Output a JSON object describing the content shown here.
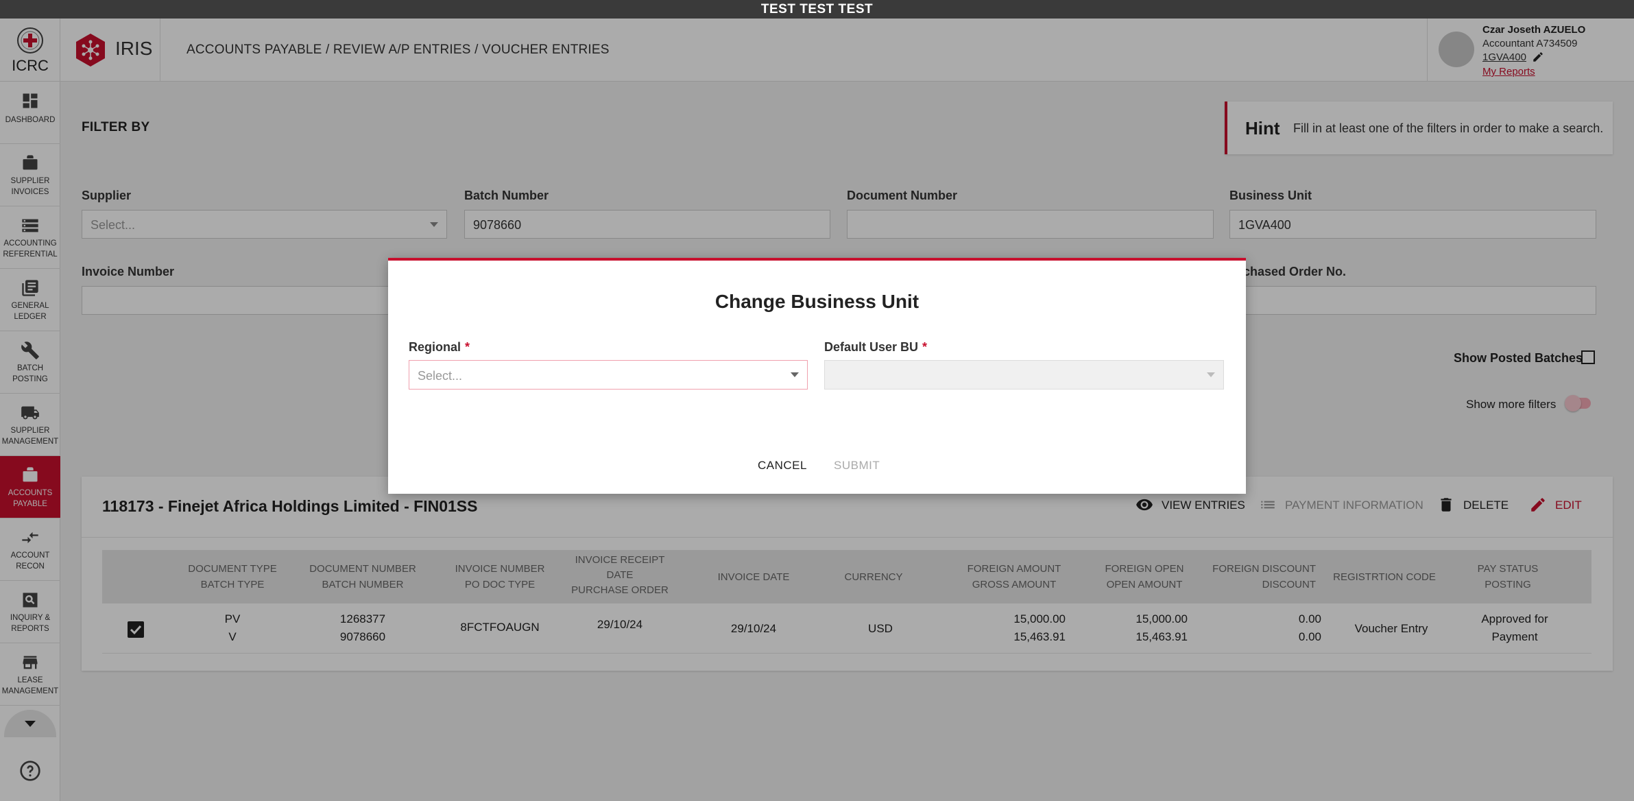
{
  "banner": "TEST TEST TEST",
  "brand": {
    "org": "ICRC",
    "app": "IRIS"
  },
  "breadcrumb": "ACCOUNTS PAYABLE / REVIEW A/P ENTRIES / VOUCHER ENTRIES",
  "user": {
    "name": "Czar Joseth AZUELO",
    "role": "Accountant A734509",
    "business_unit": "1GVA400",
    "reports_link": "My Reports"
  },
  "sidebar": {
    "items": [
      {
        "label": "DASHBOARD",
        "icon": "dashboard-icon"
      },
      {
        "label": "SUPPLIER INVOICES",
        "icon": "briefcase-icon"
      },
      {
        "label": "ACCOUNTING REFERENTIAL",
        "icon": "storage-icon"
      },
      {
        "label": "GENERAL LEDGER",
        "icon": "ledger-icon"
      },
      {
        "label": "BATCH POSTING",
        "icon": "wrench-icon"
      },
      {
        "label": "SUPPLIER MANAGEMENT",
        "icon": "truck-icon"
      },
      {
        "label": "ACCOUNTS PAYABLE",
        "icon": "briefcase-icon",
        "active": true
      },
      {
        "label": "ACCOUNT RECON",
        "icon": "compare-arrows-icon"
      },
      {
        "label": "INQUIRY & REPORTS",
        "icon": "search-icon"
      },
      {
        "label": "LEASE MANAGEMENT",
        "icon": "store-icon"
      }
    ]
  },
  "filters": {
    "title": "FILTER BY",
    "hint_title": "Hint",
    "hint_text": "Fill in at least one of the filters in order to make a search.",
    "supplier": {
      "label": "Supplier",
      "placeholder": "Select..."
    },
    "batch_number": {
      "label": "Batch Number",
      "value": "9078660"
    },
    "document_number": {
      "label": "Document Number",
      "value": ""
    },
    "business_unit": {
      "label": "Business Unit",
      "value": "1GVA400"
    },
    "invoice_number": {
      "label": "Invoice Number",
      "value": ""
    },
    "purchased_order": {
      "label": "Purchased Order No.",
      "label_visible": "rchased Order No.",
      "value": ""
    },
    "show_posted_batches": {
      "label": "Show Posted Batches",
      "checked": false
    },
    "show_more_filters": {
      "label": "Show more filters",
      "on": false
    }
  },
  "result": {
    "title": "118173 - Finejet Africa Holdings Limited - FIN01SS",
    "actions": {
      "view_entries": "VIEW ENTRIES",
      "payment_information": "PAYMENT INFORMATION",
      "delete": "DELETE",
      "edit": "EDIT"
    },
    "columns": {
      "doc_type": [
        "DOCUMENT TYPE",
        "BATCH TYPE"
      ],
      "doc_number": [
        "DOCUMENT NUMBER",
        "BATCH NUMBER"
      ],
      "invoice_number": [
        "INVOICE NUMBER",
        "PO DOC TYPE"
      ],
      "receipt_date": [
        "INVOICE RECEIPT",
        "DATE",
        "PURCHASE ORDER"
      ],
      "invoice_date": [
        "INVOICE DATE"
      ],
      "currency": [
        "CURRENCY"
      ],
      "foreign_amount": [
        "FOREIGN AMOUNT",
        "GROSS AMOUNT"
      ],
      "foreign_open": [
        "FOREIGN OPEN",
        "OPEN AMOUNT"
      ],
      "foreign_discount": [
        "FOREIGN DISCOUNT",
        "DISCOUNT"
      ],
      "registration_code": [
        "REGISTRTION CODE"
      ],
      "pay_status": [
        "PAY STATUS",
        "POSTING"
      ]
    },
    "row": {
      "checked": true,
      "doc_type": "PV",
      "batch_type": "V",
      "doc_number": "1268377",
      "batch_number": "9078660",
      "invoice_number": "8FCTFOAUGN",
      "receipt_date": "29/10/24",
      "invoice_date": "29/10/24",
      "currency": "USD",
      "foreign_amount": "15,000.00",
      "gross_amount": "15,463.91",
      "foreign_open": "15,000.00",
      "open_amount": "15,463.91",
      "foreign_discount": "0.00",
      "discount": "0.00",
      "registration_code": "Voucher Entry",
      "pay_status": "Approved for Payment"
    }
  },
  "modal": {
    "title": "Change Business Unit",
    "regional": {
      "label": "Regional",
      "placeholder": "Select..."
    },
    "default_bu": {
      "label": "Default User BU",
      "value": ""
    },
    "cancel": "CANCEL",
    "submit": "SUBMIT"
  },
  "colors": {
    "brand_red": "#c8102e",
    "banner": "#3a3a3a"
  }
}
